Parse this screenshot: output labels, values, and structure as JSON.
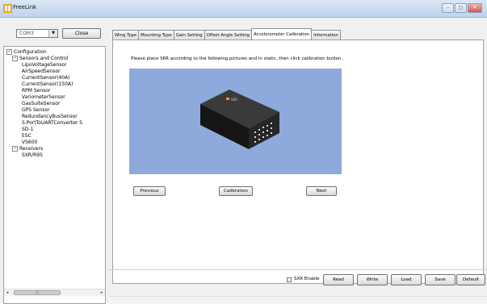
{
  "window": {
    "title": "FreeLink",
    "minimize": "–",
    "maximize": "▢",
    "close": "✕"
  },
  "connection": {
    "port": "COM3",
    "close_label": "Close"
  },
  "tree": {
    "root": "Configuration",
    "group1": "Sensors and Control",
    "sensors": [
      "LipoVoltageSensor",
      "AirSpeedSensor",
      "CurrentSensor(40A)",
      "CurrentSensor(150A)",
      "RPM Sensor",
      "VariometerSensor",
      "GasSuiteSensor",
      "GPS Sensor",
      "RedundancyBusSensor",
      "S.PortToUARTConverter S",
      "SD-1",
      "ESC",
      "VS600"
    ],
    "group2": "Receivers",
    "receivers": [
      "SXR/R9S"
    ],
    "scroll_arrow_left": "◂",
    "scroll_arrow_right": "▸",
    "scroll_grip": "|||"
  },
  "tabs": [
    "Wing Type",
    "Mounting Type",
    "Gain Setting",
    "Offset Angle Setting",
    "Accelerometer Calibration",
    "Information"
  ],
  "active_tab": "Accelerometer Calibration",
  "calibration": {
    "instruction": "Please place S6R according to the following pictures and in static, then click calibration button .",
    "device_label": "S6R",
    "previous_label": "Previous",
    "calibration_label": "Calibration",
    "next_label": "Next"
  },
  "bottom": {
    "sxr_enable_label": "SXR Enable",
    "read": "Read",
    "write": "Write",
    "load": "Load",
    "save": "Save",
    "default": "Default"
  }
}
